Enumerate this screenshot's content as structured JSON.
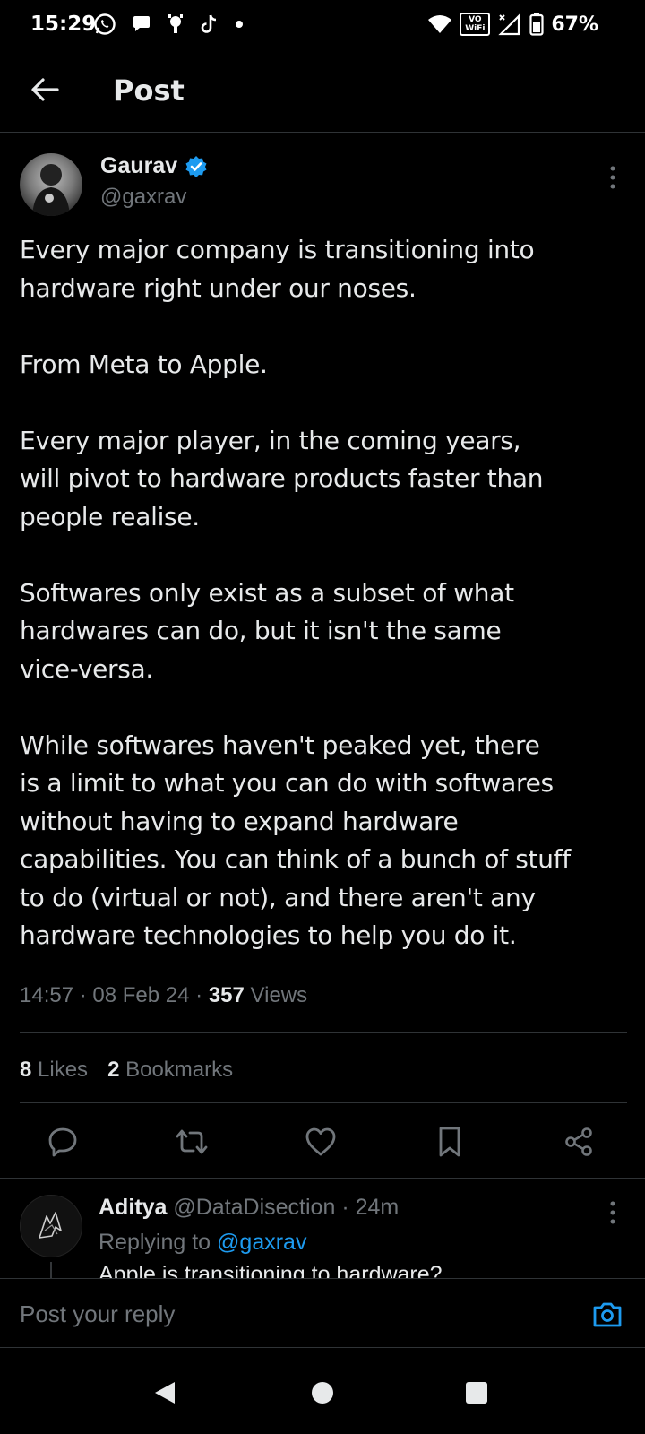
{
  "status_bar": {
    "time": "15:29",
    "left_icons": [
      "whatsapp-icon",
      "chat-bubble-icon",
      "notification-app-icon",
      "tiktok-icon",
      "dot-icon"
    ],
    "vowifi_top": "VO",
    "vowifi_bottom": "WiFi",
    "battery_percent": "67%"
  },
  "header": {
    "title": "Post"
  },
  "tweet": {
    "author_name": "Gaurav",
    "author_handle": "@gaxrav",
    "verified": true,
    "paragraphs": [
      "Every major company is transitioning into\nhardware right under our noses.",
      "From Meta to Apple.",
      "Every major player, in the coming years,\nwill pivot to hardware products faster than\npeople realise.",
      "Softwares only exist as a subset of what\nhardwares can do, but it isn't the same\nvice-versa.",
      "While softwares haven't peaked yet, there\nis a limit to what you can do with softwares\nwithout having to expand hardware\ncapabilities. You can think of a bunch of stuff\nto do (virtual or not), and there aren't any\nhardware technologies to help you do it."
    ],
    "time": "14:57",
    "date": "08 Feb 24",
    "views_count": "357",
    "views_label": "Views",
    "likes_count": "8",
    "likes_label": "Likes",
    "bookmarks_count": "2",
    "bookmarks_label": "Bookmarks"
  },
  "reply": {
    "author_name": "Aditya",
    "author_handle": "@DataDisection",
    "age": "24m",
    "replying_label": "Replying to",
    "replying_to": "@gaxrav",
    "text_partial": "Apple is transitioning to hardware?"
  },
  "composer": {
    "placeholder": "Post your reply"
  },
  "colors": {
    "background": "#000000",
    "text_primary": "#e7e9ea",
    "text_secondary": "#71767b",
    "accent": "#1d9bf0",
    "divider": "#2f3336"
  }
}
